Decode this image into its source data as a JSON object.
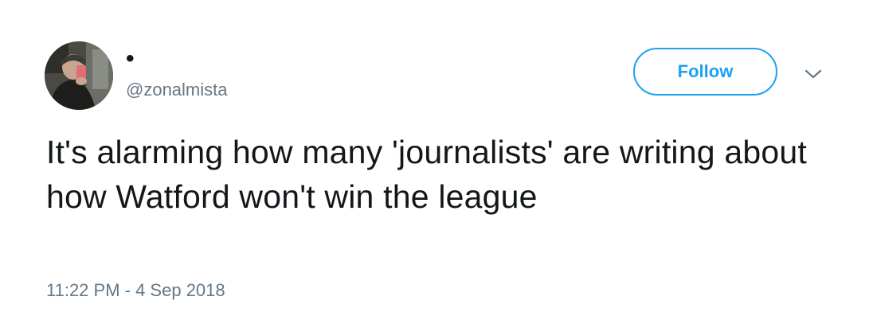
{
  "user": {
    "display_name": "•",
    "handle": "@zonalmista",
    "avatar_icon": "profile-photo"
  },
  "actions": {
    "follow_label": "Follow",
    "more_icon": "chevron-down-icon"
  },
  "tweet": {
    "text": "It's alarming how many 'journalists' are writing about how Watford won't win the league",
    "timestamp": "11:22 PM - 4 Sep 2018"
  },
  "colors": {
    "accent": "#1da1f2",
    "text": "#14171a",
    "muted": "#657786",
    "background": "#ffffff"
  }
}
